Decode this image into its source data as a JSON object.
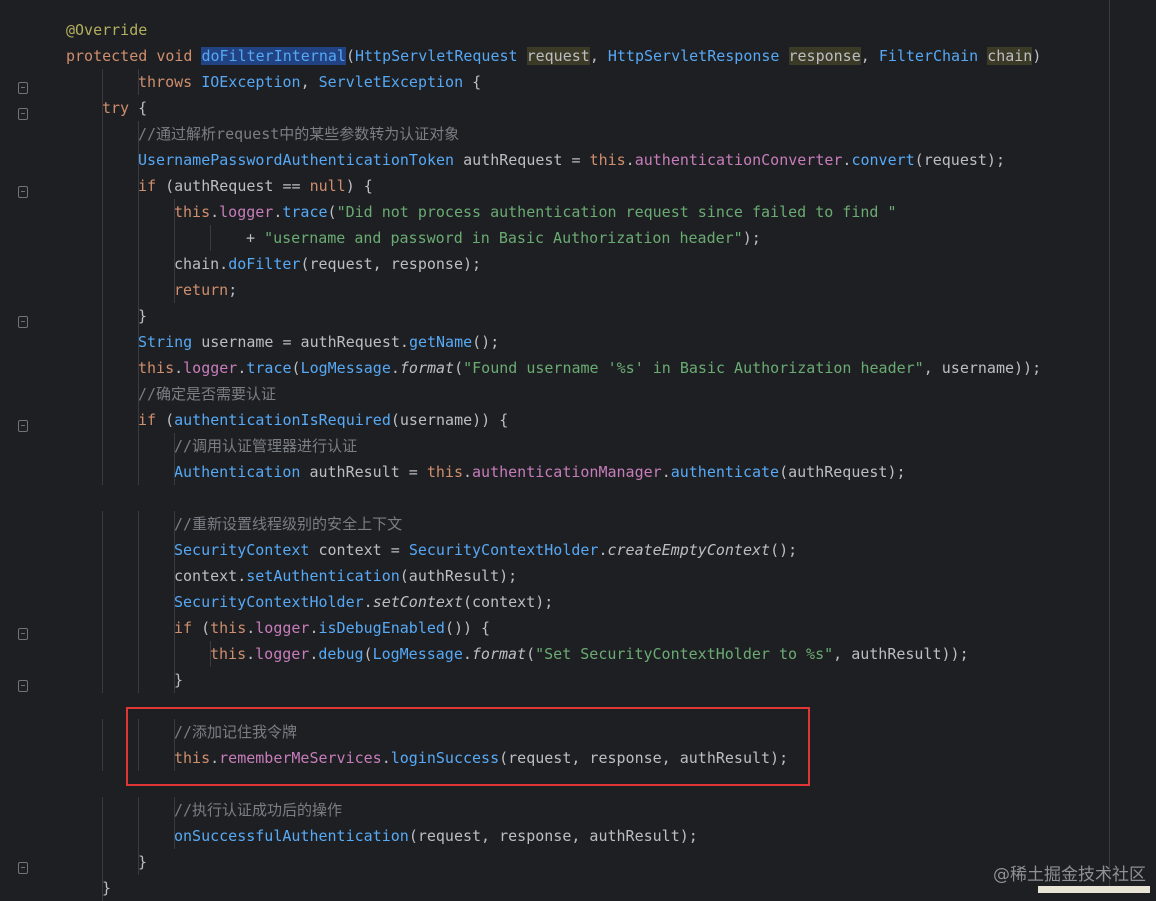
{
  "editor": {
    "watermark": "@稀土掘金技术社区",
    "lines": [
      {
        "indent": 0,
        "tokens": [
          {
            "t": "@Override",
            "c": "ann"
          }
        ]
      },
      {
        "indent": 0,
        "tokens": [
          {
            "t": "protected ",
            "c": "kw"
          },
          {
            "t": "void ",
            "c": "kw"
          },
          {
            "t": "doFilterInternal",
            "c": "sel-method"
          },
          {
            "t": "(",
            "c": ""
          },
          {
            "t": "HttpServletRequest ",
            "c": "type"
          },
          {
            "t": "request",
            "c": "hl-param"
          },
          {
            "t": ", ",
            "c": ""
          },
          {
            "t": "HttpServletResponse ",
            "c": "type"
          },
          {
            "t": "response",
            "c": "hl-param"
          },
          {
            "t": ", ",
            "c": ""
          },
          {
            "t": "FilterChain ",
            "c": "type"
          },
          {
            "t": "chain",
            "c": "hl-param"
          },
          {
            "t": ")",
            "c": ""
          }
        ]
      },
      {
        "indent": 2,
        "tokens": [
          {
            "t": "throws ",
            "c": "kw"
          },
          {
            "t": "IOException",
            "c": "type"
          },
          {
            "t": ", ",
            "c": ""
          },
          {
            "t": "ServletException",
            "c": "type"
          },
          {
            "t": " {",
            "c": ""
          }
        ]
      },
      {
        "indent": 1,
        "tokens": [
          {
            "t": "try ",
            "c": "kw"
          },
          {
            "t": "{",
            "c": ""
          }
        ]
      },
      {
        "indent": 2,
        "tokens": [
          {
            "t": "//通过解析request中的某些参数转为认证对象",
            "c": "cmt"
          }
        ]
      },
      {
        "indent": 2,
        "tokens": [
          {
            "t": "UsernamePasswordAuthenticationToken ",
            "c": "type"
          },
          {
            "t": "authRequest = ",
            "c": ""
          },
          {
            "t": "this",
            "c": "kw"
          },
          {
            "t": ".",
            "c": ""
          },
          {
            "t": "authenticationConverter",
            "c": "fld"
          },
          {
            "t": ".",
            "c": ""
          },
          {
            "t": "convert",
            "c": "mcall"
          },
          {
            "t": "(request);",
            "c": ""
          }
        ]
      },
      {
        "indent": 2,
        "tokens": [
          {
            "t": "if ",
            "c": "kw"
          },
          {
            "t": "(authRequest == ",
            "c": ""
          },
          {
            "t": "null",
            "c": "kw"
          },
          {
            "t": ") {",
            "c": ""
          }
        ]
      },
      {
        "indent": 3,
        "tokens": [
          {
            "t": "this",
            "c": "kw"
          },
          {
            "t": ".",
            "c": ""
          },
          {
            "t": "logger",
            "c": "fld"
          },
          {
            "t": ".",
            "c": ""
          },
          {
            "t": "trace",
            "c": "mcall"
          },
          {
            "t": "(",
            "c": ""
          },
          {
            "t": "\"Did not process authentication request since failed to find \"",
            "c": "str"
          }
        ]
      },
      {
        "indent": 5,
        "tokens": [
          {
            "t": "+ ",
            "c": ""
          },
          {
            "t": "\"username and password in Basic Authorization header\"",
            "c": "str"
          },
          {
            "t": ");",
            "c": ""
          }
        ]
      },
      {
        "indent": 3,
        "tokens": [
          {
            "t": "chain.",
            "c": ""
          },
          {
            "t": "doFilter",
            "c": "mcall"
          },
          {
            "t": "(request, response);",
            "c": ""
          }
        ]
      },
      {
        "indent": 3,
        "tokens": [
          {
            "t": "return",
            "c": "kw"
          },
          {
            "t": ";",
            "c": ""
          }
        ]
      },
      {
        "indent": 2,
        "tokens": [
          {
            "t": "}",
            "c": ""
          }
        ]
      },
      {
        "indent": 2,
        "tokens": [
          {
            "t": "String ",
            "c": "type"
          },
          {
            "t": "username = authRequest.",
            "c": ""
          },
          {
            "t": "getName",
            "c": "mcall"
          },
          {
            "t": "();",
            "c": ""
          }
        ]
      },
      {
        "indent": 2,
        "tokens": [
          {
            "t": "this",
            "c": "kw"
          },
          {
            "t": ".",
            "c": ""
          },
          {
            "t": "logger",
            "c": "fld"
          },
          {
            "t": ".",
            "c": ""
          },
          {
            "t": "trace",
            "c": "mcall"
          },
          {
            "t": "(",
            "c": ""
          },
          {
            "t": "LogMessage",
            "c": "type"
          },
          {
            "t": ".",
            "c": ""
          },
          {
            "t": "format",
            "c": "ital"
          },
          {
            "t": "(",
            "c": ""
          },
          {
            "t": "\"Found username '%s' in Basic Authorization header\"",
            "c": "str"
          },
          {
            "t": ", username));",
            "c": ""
          }
        ]
      },
      {
        "indent": 2,
        "tokens": [
          {
            "t": "//确定是否需要认证",
            "c": "cmt"
          }
        ]
      },
      {
        "indent": 2,
        "tokens": [
          {
            "t": "if ",
            "c": "kw"
          },
          {
            "t": "(",
            "c": ""
          },
          {
            "t": "authenticationIsRequired",
            "c": "mcall"
          },
          {
            "t": "(username)) {",
            "c": ""
          }
        ]
      },
      {
        "indent": 3,
        "tokens": [
          {
            "t": "//调用认证管理器进行认证",
            "c": "cmt"
          }
        ]
      },
      {
        "indent": 3,
        "tokens": [
          {
            "t": "Authentication ",
            "c": "type"
          },
          {
            "t": "authResult = ",
            "c": ""
          },
          {
            "t": "this",
            "c": "kw"
          },
          {
            "t": ".",
            "c": ""
          },
          {
            "t": "authenticationManager",
            "c": "fld"
          },
          {
            "t": ".",
            "c": ""
          },
          {
            "t": "authenticate",
            "c": "mcall"
          },
          {
            "t": "(authRequest);",
            "c": ""
          }
        ]
      },
      {
        "indent": 0,
        "tokens": []
      },
      {
        "indent": 3,
        "tokens": [
          {
            "t": "//重新设置线程级别的安全上下文",
            "c": "cmt"
          }
        ]
      },
      {
        "indent": 3,
        "tokens": [
          {
            "t": "SecurityContext ",
            "c": "type"
          },
          {
            "t": "context = ",
            "c": ""
          },
          {
            "t": "SecurityContextHolder",
            "c": "type"
          },
          {
            "t": ".",
            "c": ""
          },
          {
            "t": "createEmptyContext",
            "c": "ital"
          },
          {
            "t": "();",
            "c": ""
          }
        ]
      },
      {
        "indent": 3,
        "tokens": [
          {
            "t": "context.",
            "c": ""
          },
          {
            "t": "setAuthentication",
            "c": "mcall"
          },
          {
            "t": "(authResult);",
            "c": ""
          }
        ]
      },
      {
        "indent": 3,
        "tokens": [
          {
            "t": "SecurityContextHolder",
            "c": "type"
          },
          {
            "t": ".",
            "c": ""
          },
          {
            "t": "setContext",
            "c": "ital"
          },
          {
            "t": "(context);",
            "c": ""
          }
        ]
      },
      {
        "indent": 3,
        "tokens": [
          {
            "t": "if ",
            "c": "kw"
          },
          {
            "t": "(",
            "c": ""
          },
          {
            "t": "this",
            "c": "kw"
          },
          {
            "t": ".",
            "c": ""
          },
          {
            "t": "logger",
            "c": "fld"
          },
          {
            "t": ".",
            "c": ""
          },
          {
            "t": "isDebugEnabled",
            "c": "mcall"
          },
          {
            "t": "()) {",
            "c": ""
          }
        ]
      },
      {
        "indent": 4,
        "tokens": [
          {
            "t": "this",
            "c": "kw"
          },
          {
            "t": ".",
            "c": ""
          },
          {
            "t": "logger",
            "c": "fld"
          },
          {
            "t": ".",
            "c": ""
          },
          {
            "t": "debug",
            "c": "mcall"
          },
          {
            "t": "(",
            "c": ""
          },
          {
            "t": "LogMessage",
            "c": "type"
          },
          {
            "t": ".",
            "c": ""
          },
          {
            "t": "format",
            "c": "ital"
          },
          {
            "t": "(",
            "c": ""
          },
          {
            "t": "\"Set SecurityContextHolder to %s\"",
            "c": "str"
          },
          {
            "t": ", authResult));",
            "c": ""
          }
        ]
      },
      {
        "indent": 3,
        "tokens": [
          {
            "t": "}",
            "c": ""
          }
        ]
      },
      {
        "indent": 0,
        "tokens": []
      },
      {
        "indent": 3,
        "tokens": [
          {
            "t": "//添加记住我令牌",
            "c": "cmt"
          }
        ]
      },
      {
        "indent": 3,
        "tokens": [
          {
            "t": "this",
            "c": "kw"
          },
          {
            "t": ".",
            "c": ""
          },
          {
            "t": "rememberMeServices",
            "c": "fld"
          },
          {
            "t": ".",
            "c": ""
          },
          {
            "t": "loginSuccess",
            "c": "mcall"
          },
          {
            "t": "(request, response, authResult);",
            "c": ""
          }
        ]
      },
      {
        "indent": 0,
        "tokens": []
      },
      {
        "indent": 3,
        "tokens": [
          {
            "t": "//执行认证成功后的操作",
            "c": "cmt"
          }
        ]
      },
      {
        "indent": 3,
        "tokens": [
          {
            "t": "onSuccessfulAuthentication",
            "c": "mcall"
          },
          {
            "t": "(request, response, authResult);",
            "c": ""
          }
        ]
      },
      {
        "indent": 2,
        "tokens": [
          {
            "t": "}",
            "c": ""
          }
        ]
      },
      {
        "indent": 1,
        "tokens": [
          {
            "t": "}",
            "c": ""
          }
        ]
      }
    ]
  }
}
